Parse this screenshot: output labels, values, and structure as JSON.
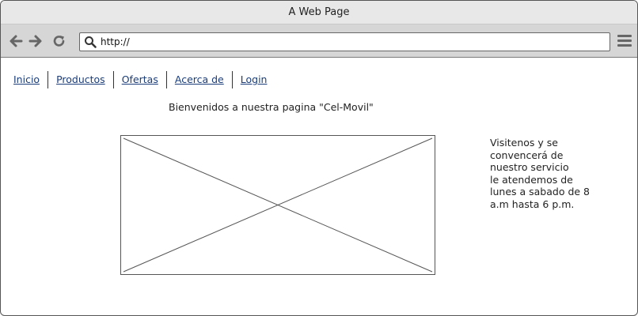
{
  "window": {
    "title": "A Web Page"
  },
  "toolbar": {
    "back_icon": "back-arrow-icon",
    "forward_icon": "forward-arrow-icon",
    "reload_icon": "reload-icon",
    "search_icon": "search-icon",
    "url": "http://",
    "menu_icon": "hamburger-menu-icon"
  },
  "nav": {
    "items": [
      {
        "label": "Inicio"
      },
      {
        "label": "Productos"
      },
      {
        "label": "Ofertas"
      },
      {
        "label": "Acerca de"
      },
      {
        "label": "Login"
      }
    ]
  },
  "main": {
    "welcome": "Bienvenidos a nuestra pagina \"Cel-Movil\"",
    "side_lines": [
      "Visitenos y se",
      "convencerá de",
      "nuestro servicio",
      "le atendemos de",
      "lunes a sabado de 8",
      "a.m hasta 6 p.m."
    ]
  },
  "colors": {
    "link": "#1a3d7a",
    "toolbar_bg": "#d6d6d6",
    "titlebar_bg": "#e8e8e8"
  }
}
